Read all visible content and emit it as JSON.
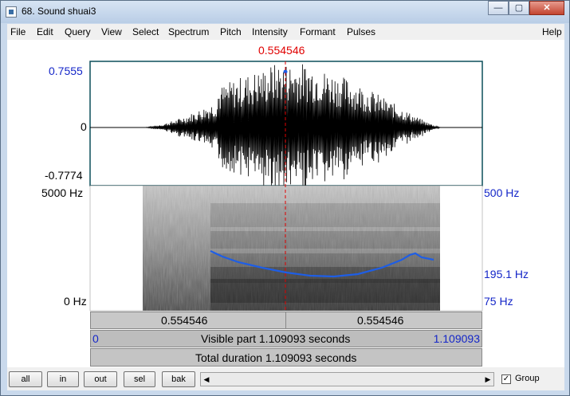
{
  "window": {
    "title": "68. Sound shuai3",
    "minimize_glyph": "—",
    "maximize_glyph": "▢",
    "close_glyph": "✕"
  },
  "menu": [
    "File",
    "Edit",
    "Query",
    "View",
    "Select",
    "Spectrum",
    "Pitch",
    "Intensity",
    "Formant",
    "Pulses"
  ],
  "help_label": "Help",
  "cursor": {
    "time_label": "0.554546",
    "time": 0.554546
  },
  "waveform": {
    "max_label": "0.7555",
    "zero_label": "0",
    "min_label": "-0.7774"
  },
  "spectrogram": {
    "freq_top_label": "5000 Hz",
    "freq_bottom_label": "0 Hz"
  },
  "pitch": {
    "top_label": "500 Hz",
    "value_label": "195.1 Hz",
    "bottom_label": "75 Hz"
  },
  "time_bar": {
    "left_segment": "0.554546",
    "right_segment": "0.554546",
    "start_label": "0",
    "visible_label": "Visible part 1.109093 seconds",
    "end_label": "1.109093",
    "total_label": "Total duration 1.109093 seconds"
  },
  "bottom_buttons": {
    "all": "all",
    "in": "in",
    "out": "out",
    "sel": "sel",
    "bak": "bak"
  },
  "scroll": {
    "left_arrow": "◀",
    "right_arrow": "▶"
  },
  "group": {
    "label": "Group",
    "checked": true,
    "check_glyph": "✓"
  },
  "colors": {
    "axis_blue": "#1426c8",
    "cursor_red": "#e00000",
    "pitch_blue": "#1e5ee6"
  }
}
